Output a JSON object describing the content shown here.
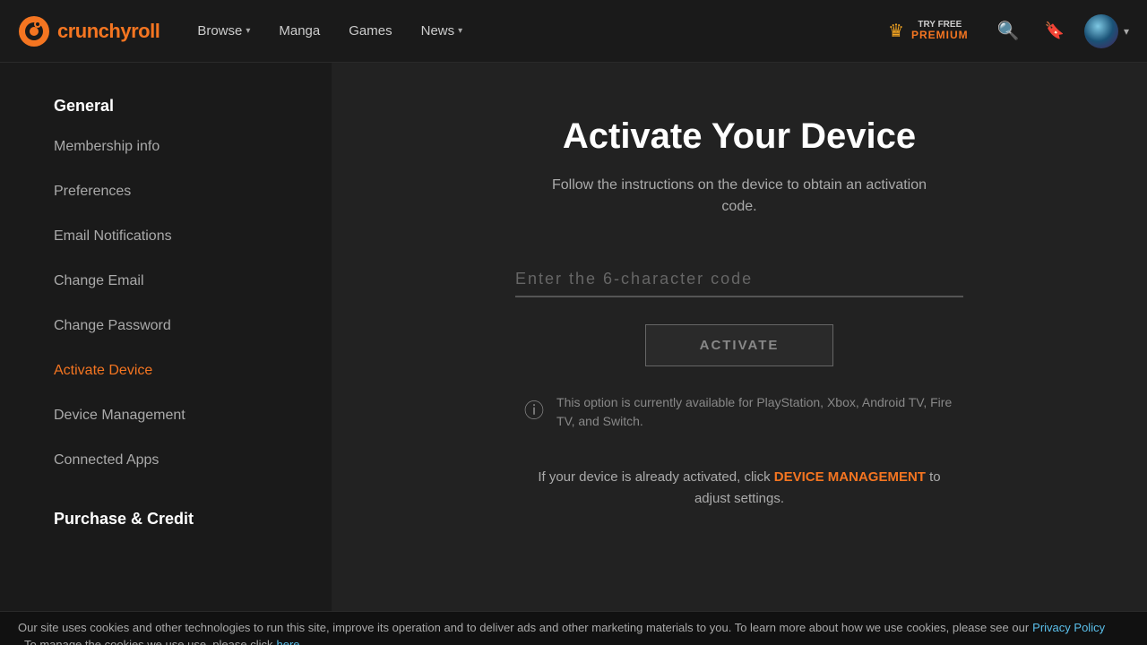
{
  "header": {
    "logo_text": "crunchyroll",
    "nav_items": [
      {
        "label": "Browse",
        "has_dropdown": true
      },
      {
        "label": "Manga",
        "has_dropdown": false
      },
      {
        "label": "Games",
        "has_dropdown": false
      },
      {
        "label": "News",
        "has_dropdown": true
      }
    ],
    "premium": {
      "try_free": "TRY FREE",
      "label": "PREMIUM"
    },
    "icons": {
      "search": "🔍",
      "bookmark": "🔖",
      "chevron": "▾"
    }
  },
  "sidebar": {
    "sections": [
      {
        "title": "General",
        "items": [
          {
            "label": "Membership info",
            "active": false
          },
          {
            "label": "Preferences",
            "active": false
          },
          {
            "label": "Email Notifications",
            "active": false
          },
          {
            "label": "Change Email",
            "active": false
          },
          {
            "label": "Change Password",
            "active": false
          },
          {
            "label": "Activate Device",
            "active": true
          },
          {
            "label": "Device Management",
            "active": false
          },
          {
            "label": "Connected Apps",
            "active": false
          }
        ]
      },
      {
        "title": "Purchase & Credit",
        "items": []
      }
    ]
  },
  "main": {
    "title": "Activate Your Device",
    "subtitle": "Follow the instructions on the device to obtain an activation code.",
    "input_label": "Enter the 6-character code",
    "input_placeholder": "",
    "activate_button": "ACTIVATE",
    "info_text": "This option is currently available for PlayStation, Xbox, Android TV, Fire TV, and Switch.",
    "device_mgmt_text_before": "If your device is already activated, click",
    "device_mgmt_link": "DEVICE MANAGEMENT",
    "device_mgmt_text_after": "to adjust settings."
  },
  "cookie": {
    "text_before": "Our site uses cookies and other technologies to run this site, improve its operation and to deliver ads and other marketing materials to you. To learn more about how we use",
    "text_middle": "cookies, please see our",
    "privacy_link": "Privacy Policy",
    "text_after": ". To manage the cookies we use use, please click",
    "here_link": "here"
  },
  "colors": {
    "orange": "#f47521",
    "background": "#1a1a1a",
    "content_bg": "#222222",
    "text_muted": "#aaaaaa",
    "link_blue": "#5bc0eb"
  }
}
